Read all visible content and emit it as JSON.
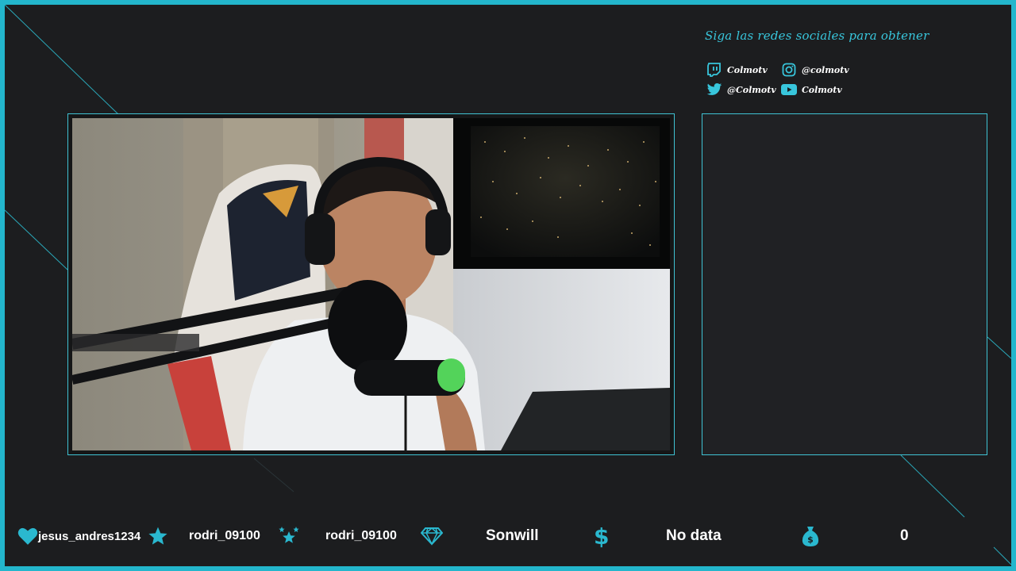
{
  "social": {
    "title": "Siga las redes sociales para obtener",
    "twitch": {
      "icon": "twitch-icon",
      "label": "Colmotv"
    },
    "instagram": {
      "icon": "instagram-icon",
      "label": "@colmotv"
    },
    "twitter": {
      "icon": "twitter-icon",
      "label": "@Colmotv"
    },
    "youtube": {
      "icon": "youtube-icon",
      "label": "Colmotv"
    }
  },
  "stats": {
    "last_follower": {
      "icon": "heart-icon",
      "value": "jesus_andres1234"
    },
    "last_subscriber": {
      "icon": "star-icon",
      "value": "rodri_09100"
    },
    "last_gift": {
      "icon": "stars-icon",
      "value": "rodri_09100"
    },
    "top_cheer": {
      "icon": "diamond-icon",
      "value": "Sonwill"
    },
    "last_donation": {
      "icon": "dollar-icon",
      "value": "No data"
    },
    "donation_total": {
      "icon": "money-bag-icon",
      "value": "0"
    }
  },
  "colors": {
    "accent": "#23b6cc",
    "background": "#1c1d1f",
    "panel": "#202124"
  }
}
